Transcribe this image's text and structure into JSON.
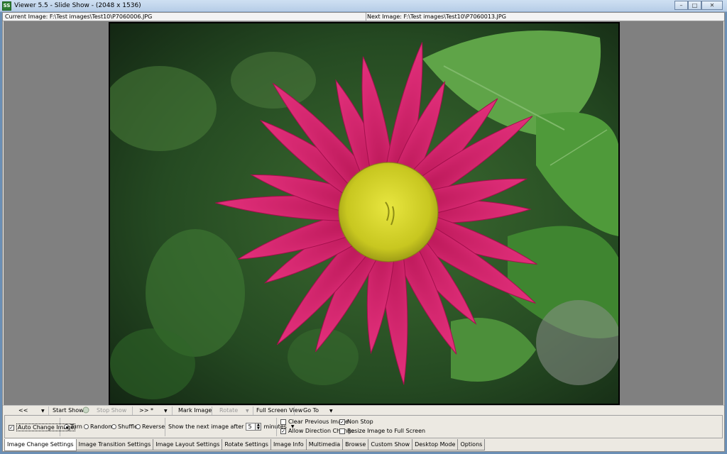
{
  "window": {
    "title": "Viewer 5.5 - Slide Show - (2048 x 1536)",
    "icon_label": "SS",
    "controls": {
      "minimize": "–",
      "maximize": "□",
      "close": "✕"
    }
  },
  "pathbar": {
    "current_image": "Current Image: F:\\Test images\\Test10\\P7060006.JPG",
    "next_image": "Next Image: F:\\Test images\\Test10\\P7060013.JPG"
  },
  "toolbar": {
    "prev": "<<",
    "start_show": "Start Show",
    "stop_show": "Stop Show",
    "next": ">> *",
    "mark_image": "Mark Image",
    "rotate": "Rotate",
    "full_screen_view": "Full Screen View",
    "go_to": "Go To",
    "caret": "▼"
  },
  "options": {
    "auto_change_image": "Auto Change Image",
    "turn": "Turn",
    "random": "Random",
    "shuffle": "Shuffle",
    "reverse": "Reverse",
    "show_next_after": "Show the next image after",
    "interval_value": "5",
    "interval_unit": "minutes",
    "clear_previous_image": "Clear Previous Image",
    "allow_direction_change": "Allow Direction Change",
    "non_stop": "Non Stop",
    "resize_to_full_screen": "Resize Image to Full Screen",
    "check_mark": "✓"
  },
  "tabs": [
    "Image Change Settings",
    "Image Transition Settings",
    "Image Layout Settings",
    "Rotate Settings",
    "Image Info",
    "Multimedia",
    "Browse",
    "Custom Show",
    "Desktop Mode",
    "Options"
  ],
  "colors": {
    "petal": "#d81b6a",
    "petal_dark": "#a3104c",
    "center": "#d6d62a",
    "leaf": "#4f9a3a",
    "background_green": "#2f5a2a"
  }
}
